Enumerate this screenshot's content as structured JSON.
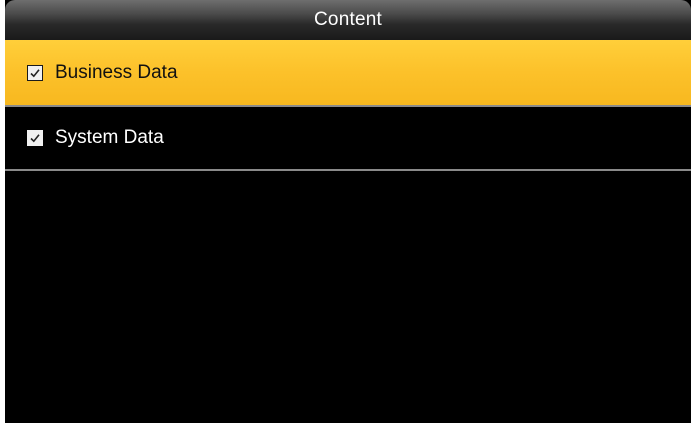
{
  "header": {
    "title": "Content"
  },
  "items": [
    {
      "label": "Business Data",
      "checked": true,
      "selected": true
    },
    {
      "label": "System Data",
      "checked": true,
      "selected": false
    }
  ],
  "colors": {
    "background": "#000000",
    "highlight": "#fcc12a",
    "divider": "#8a8a8a",
    "text": "#ffffff"
  }
}
